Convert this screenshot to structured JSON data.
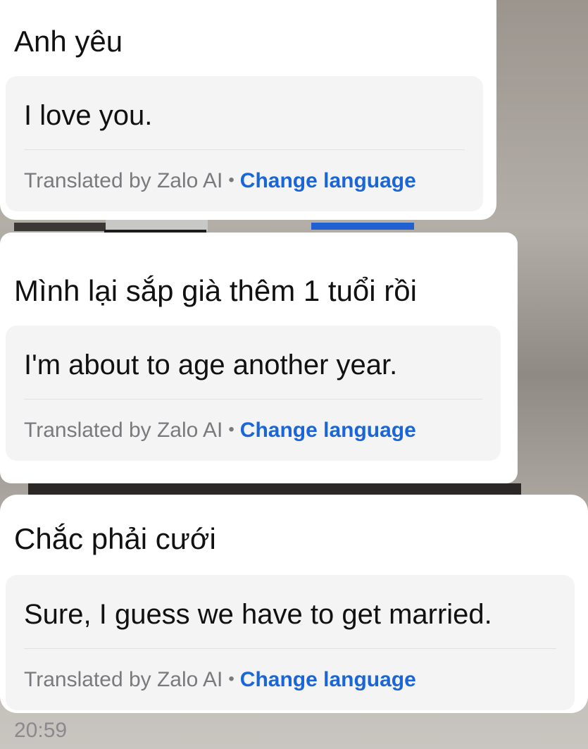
{
  "messages": [
    {
      "original": "Anh yêu",
      "translation": "I love you.",
      "translated_by": "Translated by Zalo AI",
      "separator": "•",
      "change_language": "Change language"
    },
    {
      "original": "Mình lại sắp già thêm 1 tuổi rồi",
      "translation": "I'm about to age another year.",
      "translated_by": "Translated by Zalo AI",
      "separator": "•",
      "change_language": "Change language"
    },
    {
      "original": "Chắc phải cưới",
      "translation": "Sure, I guess we have to get married.",
      "translated_by": "Translated by Zalo AI",
      "separator": "•",
      "change_language": "Change language"
    }
  ],
  "timestamp": "20:59",
  "colors": {
    "link": "#1a66d9",
    "muted": "#7a7a7e",
    "bubble": "#ffffff",
    "translation_box": "#f4f4f5"
  }
}
